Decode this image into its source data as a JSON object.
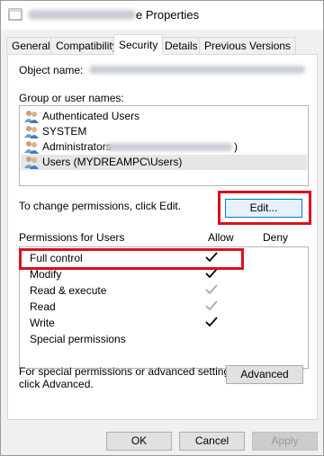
{
  "window": {
    "title_visible": "e Properties"
  },
  "tabs": [
    {
      "label": "General"
    },
    {
      "label": "Compatibility"
    },
    {
      "label": "Security"
    },
    {
      "label": "Details"
    },
    {
      "label": "Previous Versions"
    }
  ],
  "security": {
    "object_name_label": "Object name:",
    "group_label": "Group or user names:",
    "users": [
      {
        "label": "Authenticated Users",
        "icon": "users-group-icon"
      },
      {
        "label": "SYSTEM",
        "icon": "users-group-icon"
      },
      {
        "label": "Administrators",
        "suffix": ")",
        "icon": "users-group-icon"
      },
      {
        "label": "Users (MYDREAMPC\\Users)",
        "icon": "users-group-icon"
      }
    ],
    "change_text": "To change permissions, click Edit.",
    "edit_label": "Edit...",
    "permissions_label": "Permissions for Users",
    "allow_header": "Allow",
    "deny_header": "Deny",
    "permissions": [
      {
        "label": "Full control",
        "allow": "checked"
      },
      {
        "label": "Modify",
        "allow": "checked"
      },
      {
        "label": "Read & execute",
        "allow": "inherited"
      },
      {
        "label": "Read",
        "allow": "inherited"
      },
      {
        "label": "Write",
        "allow": "checked"
      },
      {
        "label": "Special permissions",
        "allow": "none"
      }
    ],
    "advanced_text_1": "For special permissions or advanced settings,",
    "advanced_text_2": "click Advanced.",
    "advanced_label": "Advanced"
  },
  "footer": {
    "ok_label": "OK",
    "cancel_label": "Cancel",
    "apply_label": "Apply"
  },
  "colors": {
    "highlight_red": "#d9101e",
    "focus_blue": "#0078d7"
  }
}
